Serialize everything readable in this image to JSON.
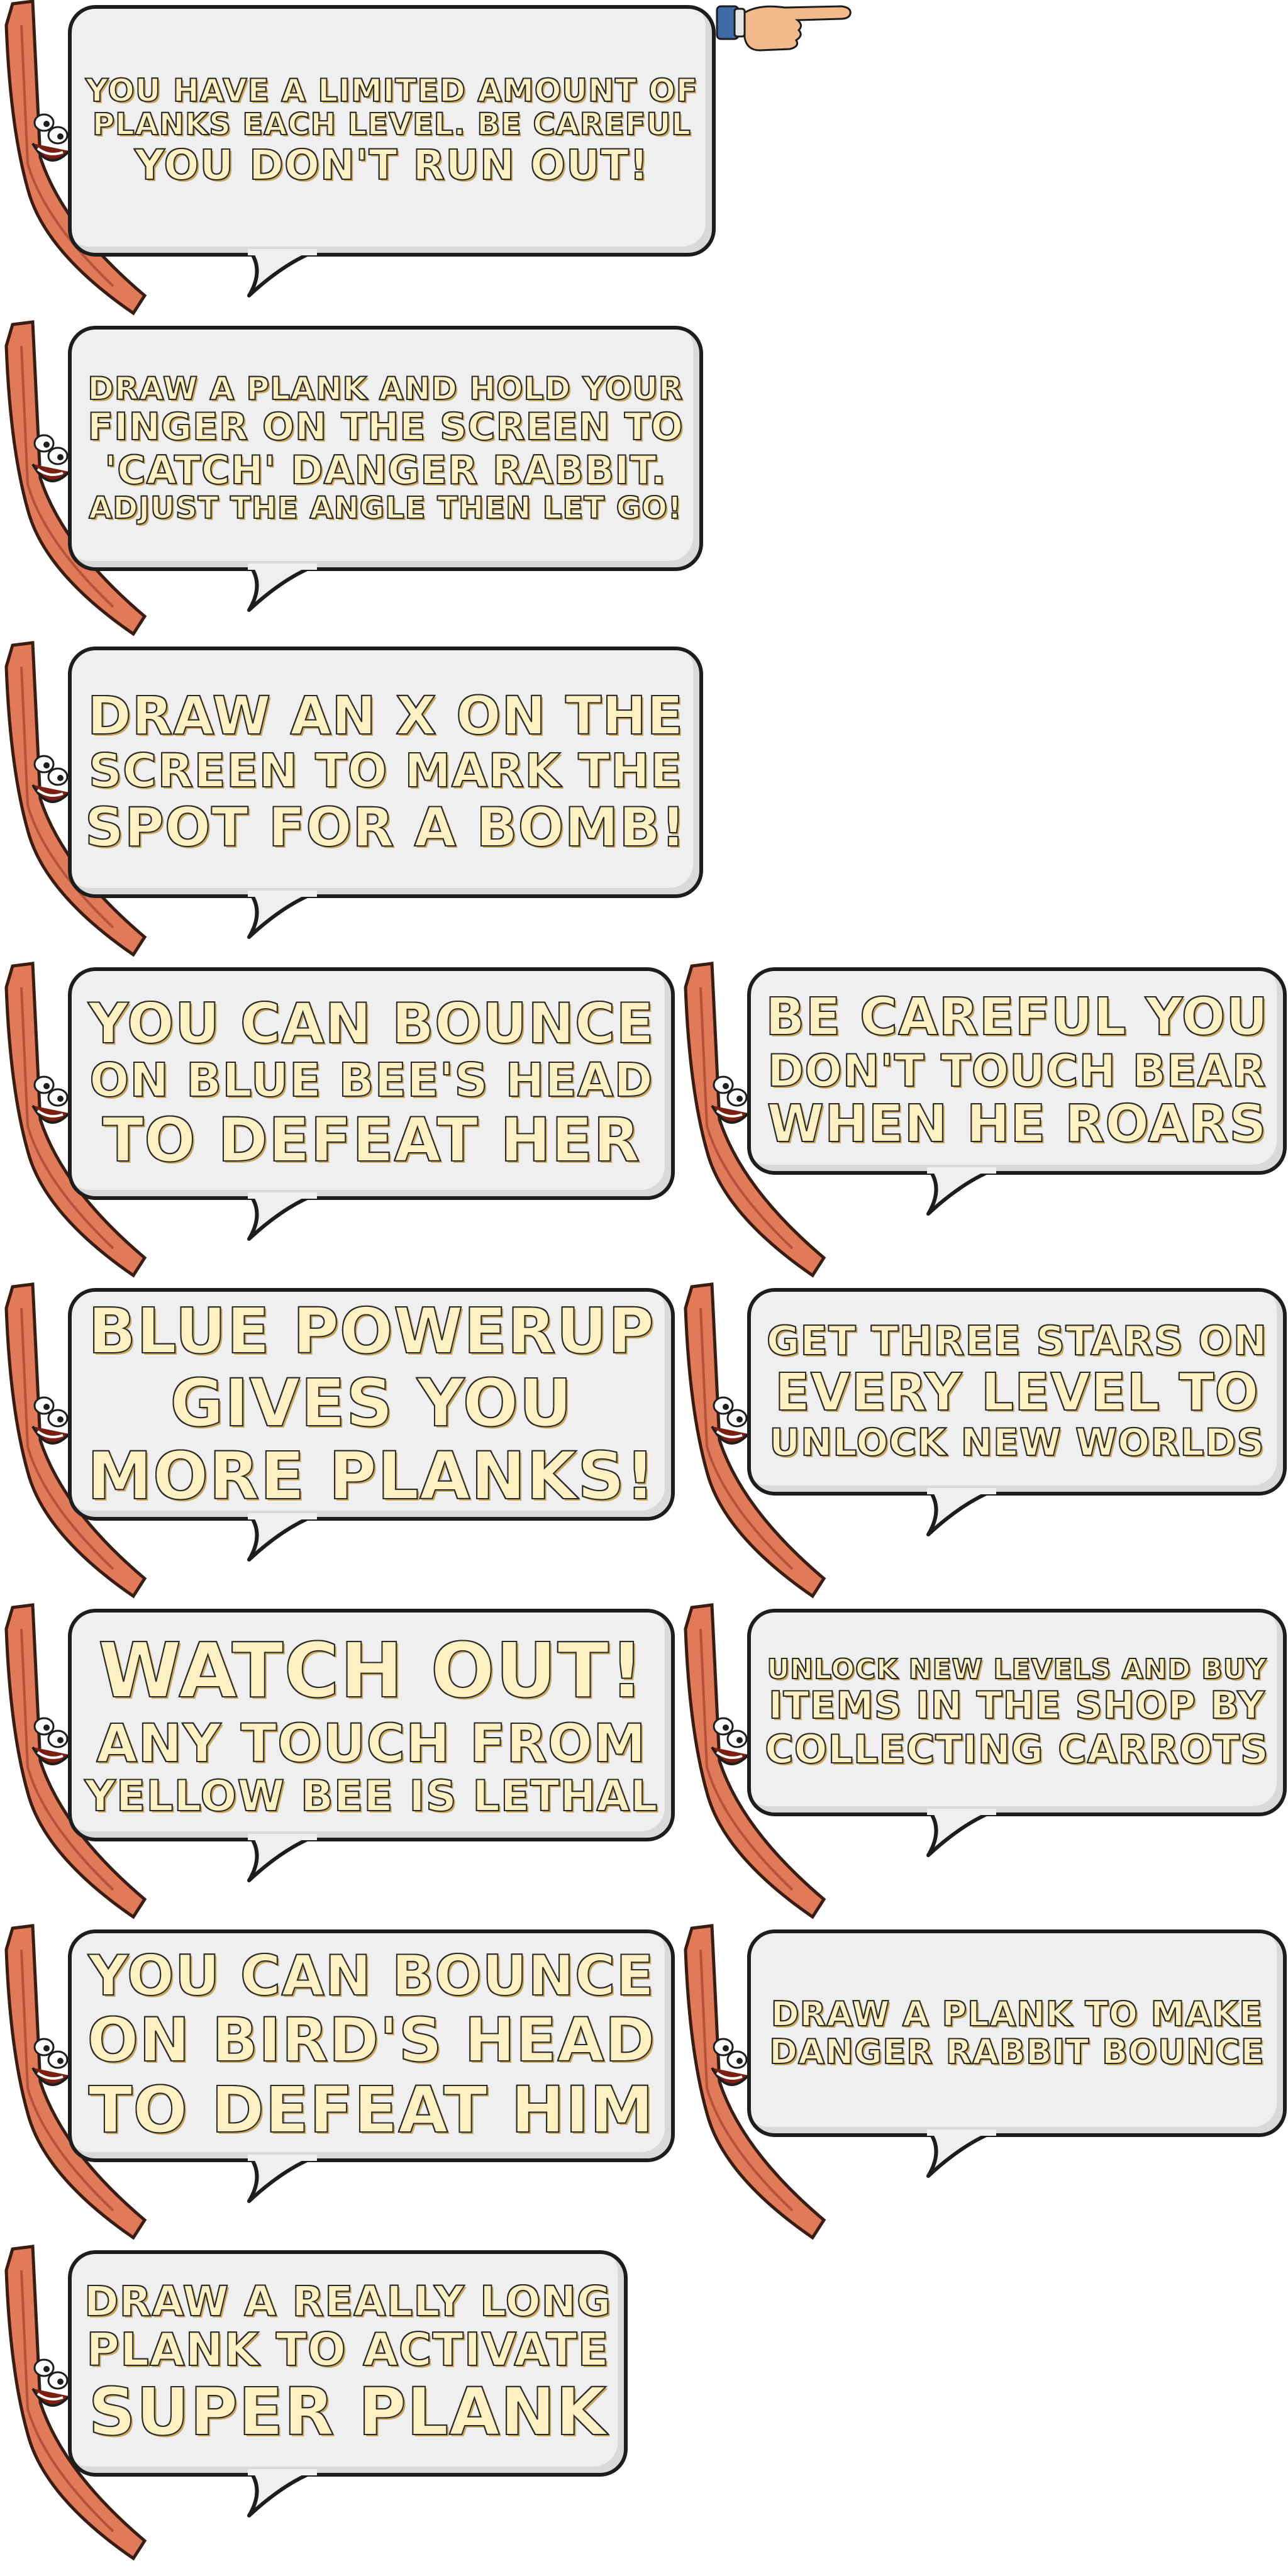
{
  "tips": [
    {
      "lines": [
        "YOU HAVE A LIMITED AMOUNT OF",
        "PLANKS EACH LEVEL. BE CAREFUL",
        "YOU DON'T RUN OUT!"
      ]
    },
    {
      "lines": [
        "DRAW A PLANK AND HOLD YOUR",
        "FINGER ON THE SCREEN TO",
        "'CATCH' DANGER RABBIT.",
        "ADJUST THE ANGLE THEN LET GO!"
      ]
    },
    {
      "lines": [
        "DRAW AN X ON THE",
        "SCREEN TO MARK THE",
        "SPOT FOR A BOMB!"
      ]
    },
    {
      "lines": [
        "YOU CAN BOUNCE",
        "ON BLUE BEE'S HEAD",
        "TO DEFEAT HER"
      ]
    },
    {
      "lines": [
        "BE CAREFUL YOU",
        "DON'T TOUCH BEAR",
        "WHEN HE ROARS"
      ]
    },
    {
      "lines": [
        "BLUE POWERUP",
        "GIVES YOU",
        "MORE PLANKS!"
      ]
    },
    {
      "lines": [
        "GET THREE STARS ON",
        "EVERY LEVEL TO",
        "UNLOCK NEW WORLDS"
      ]
    },
    {
      "lines": [
        "WATCH OUT!",
        "ANY TOUCH FROM",
        "YELLOW BEE IS LETHAL"
      ]
    },
    {
      "lines": [
        "UNLOCK NEW LEVELS AND BUY",
        "ITEMS IN THE SHOP BY",
        "COLLECTING CARROTS"
      ]
    },
    {
      "lines": [
        "YOU CAN BOUNCE",
        "ON BIRD'S HEAD",
        "TO DEFEAT HIM"
      ]
    },
    {
      "lines": [
        "DRAW A PLANK TO MAKE",
        "DANGER RABBIT BOUNCE"
      ]
    },
    {
      "lines": [
        "DRAW A REALLY LONG",
        "PLANK TO ACTIVATE",
        "SUPER PLANK"
      ]
    }
  ],
  "icons": {
    "plank": "plank-character-icon",
    "pointer": "pointing-hand-icon"
  },
  "colors": {
    "bubble": "#efefef",
    "outline": "#1d1d1d",
    "text": "#fdf1c4",
    "plank": "#e07a58"
  }
}
